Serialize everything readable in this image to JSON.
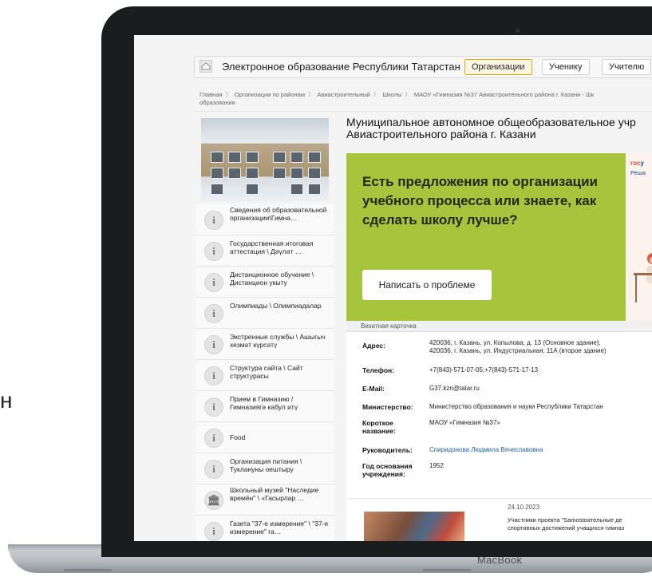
{
  "outside_char": "н",
  "laptop": {
    "brand_label": "MacBook"
  },
  "header": {
    "site_title": "Электронное образование Республики Татарстан",
    "tabs": [
      {
        "label": "Организации",
        "active": true
      },
      {
        "label": "Ученику",
        "active": false
      },
      {
        "label": "Учителю",
        "active": false
      }
    ]
  },
  "breadcrumb": [
    "Главная",
    "Организации по районам",
    "Авиастроительный",
    "Школы",
    "МАОУ «Гимназия №37 Авиастроительного района г. Казани - Шк",
    "образовании"
  ],
  "sidebar": {
    "items": [
      {
        "label": "Сведения об образовательной организации\\Гимна…",
        "icon": "info-icon"
      },
      {
        "label": "Государственная итоговая аттестация \\ Дәүләт …",
        "icon": "info-icon"
      },
      {
        "label": "Дистанционное обучение \\ Дистанцион укыту",
        "icon": "info-icon"
      },
      {
        "label": "Олимпиады \\ Олимпиадалар",
        "icon": "info-icon"
      },
      {
        "label": "Экстренные службы \\ Ашыгыч хезмәт күрсәтү",
        "icon": "info-icon"
      },
      {
        "label": "Структура сайта \\ Сайт структурасы",
        "icon": "info-icon"
      },
      {
        "label": "Прием в Гимназию / Гимназиягә кабул итү",
        "icon": "info-icon"
      },
      {
        "label": "Food",
        "icon": "info-icon"
      },
      {
        "label": "Организация питания \\ Туклануны оештыру",
        "icon": "info-icon"
      },
      {
        "label": "Школьный музей \"Наследие времён\" \\ «Гасырлар …",
        "icon": "museum-icon"
      },
      {
        "label": "Газета \"37-е измерение\" \\ \"37-е измерение\" га…",
        "icon": "info-icon"
      }
    ]
  },
  "main": {
    "org_title_line1": "Муниципальное автономное общеобразовательное учр",
    "org_title_line2": "Авиастроительного района г. Казани",
    "banner": {
      "text": "Есть предложения по организации учебного процесса или знаете, как сделать школу лучше?",
      "button": "Написать о проблеме",
      "gos_logo_part1": "гос",
      "gos_logo_part2": "у",
      "gos_sub": "Реша"
    },
    "card": {
      "header": "Визитная карточка",
      "address_label": "Адрес:",
      "address_1": "420036, г. Казань, ул. Копылова, д. 13 (Основное здание),",
      "address_2": "420036, г. Казань, ул. Индустриальная, 11А (второе здание)",
      "phone_label": "Телефон:",
      "phone": "+7(843)-571-07-05;+7(843)-571-17-13",
      "email_label": "E-Mail:",
      "email": "G37.kzn@tatar.ru",
      "ministry_label": "Министерство:",
      "ministry": "Министерство образования и науки Республики Татарстан",
      "short_label_1": "Короткое",
      "short_label_2": "название:",
      "short_name": "МАОУ «Гимназия №37»",
      "head_label": "Руководитель:",
      "head": "Спиридонова Людмила Вячеславовна",
      "founded_label_1": "Год основания",
      "founded_label_2": "учреждения:",
      "founded": "1952"
    },
    "news": {
      "date": "24.10.2023",
      "line1": "Участники проекта \"Samostoятельные де",
      "line2": "спортивных достижений учащихся гимназ"
    }
  },
  "colors": {
    "banner_bg": "#a6c53c",
    "active_tab": "#f0a500",
    "link": "#1d5fa8"
  }
}
